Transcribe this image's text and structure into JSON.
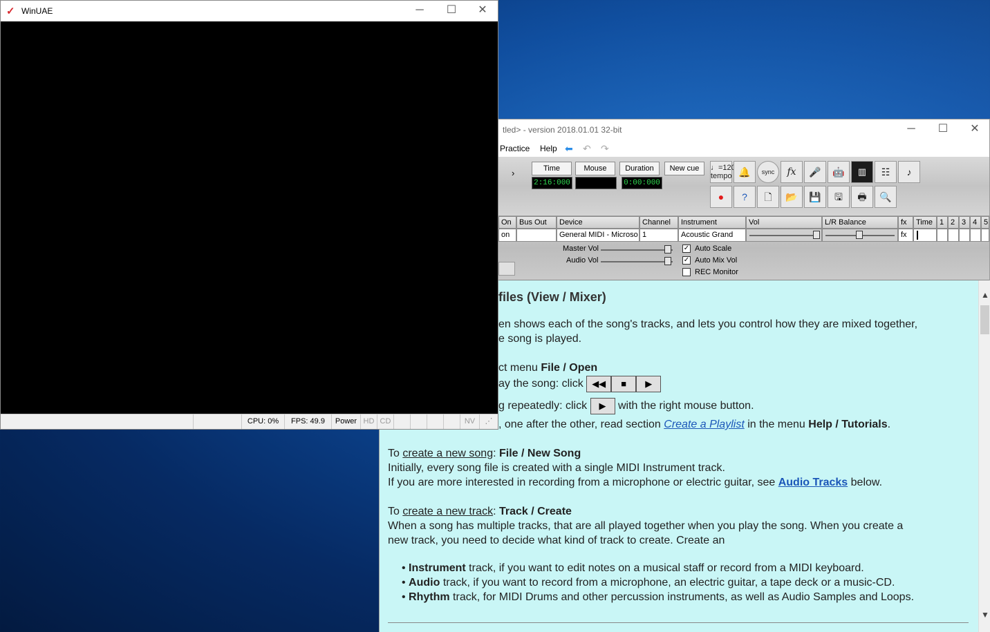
{
  "winuae": {
    "title": "WinUAE",
    "status": {
      "cpu": "CPU: 0%",
      "fps": "FPS: 49.9",
      "power": "Power",
      "hd": "HD",
      "cd": "CD",
      "nv": "NV"
    }
  },
  "app": {
    "title_fragment": "tled> - version 2018.01.01 32-bit",
    "menu": [
      "Practice",
      "Help"
    ],
    "time_labels": {
      "time": "Time",
      "mouse": "Mouse",
      "duration": "Duration",
      "new_cue": "New cue"
    },
    "time_values": {
      "time": "2:16:000",
      "mouse": "",
      "duration": "0:00:000"
    },
    "tempo": {
      "bpm": "♩=120",
      "label": "tempo"
    },
    "mixer": {
      "headers": [
        "On",
        "Bus Out",
        "Device",
        "Channel",
        "Instrument",
        "Vol",
        "L/R Balance",
        "fx",
        "Time",
        "1",
        "2",
        "3",
        "4",
        "5"
      ],
      "row": {
        "on": "on",
        "bus_out": "",
        "device": "General MIDI - Microso",
        "channel": "1",
        "instrument": "Acoustic Grand",
        "fx": "fx"
      },
      "master_vol": "Master Vol",
      "audio_vol": "Audio Vol",
      "auto_scale": "Auto Scale",
      "auto_mix_vol": "Auto Mix Vol",
      "rec_monitor": "REC Monitor"
    },
    "help": {
      "heading": "files (View / Mixer)",
      "p1a": "en shows each of the song's tracks, and lets you control how they are mixed together,",
      "p1b": "e song is played.",
      "open_pre": "ct menu ",
      "open_bold": "File / Open",
      "play_pre": "ay the song: click",
      "repeat_pre": "g repeatedly: click",
      "repeat_post": "with the right mouse button.",
      "playlist_pre": ", one after the other, read section ",
      "playlist_link": "Create a Playlist",
      "playlist_mid": " in the menu ",
      "playlist_bold": "Help / Tutorials",
      "playlist_end": ".",
      "newsong_to": "To ",
      "newsong_u": "create a new song",
      "newsong_colon": ": ",
      "newsong_bold": "File / New Song",
      "newsong_l1": "Initially, every song file is created with a single MIDI Instrument track.",
      "newsong_l2_pre": "If you are more interested in recording from a microphone or electric guitar, see ",
      "newsong_l2_link": "Audio Tracks",
      "newsong_l2_post": " below.",
      "newtrack_to": "To ",
      "newtrack_u": "create a new track",
      "newtrack_colon": ": ",
      "newtrack_bold": "Track / Create",
      "newtrack_l1": "When a song has multiple tracks, that are all played together when you play the song. When you create a",
      "newtrack_l2": "new track, you need to decide what kind of track to create. Create an",
      "bullets": [
        {
          "bold": "Instrument",
          "text": " track, if you want to edit notes on a musical staff or record from a MIDI keyboard."
        },
        {
          "bold": "Audio",
          "text": " track, if you want to record from a microphone, an electric guitar, a tape deck or a music-CD."
        },
        {
          "bold": "Rhythm",
          "text": " track, for MIDI Drums and other percussion instruments, as well as Audio Samples and Loops."
        }
      ]
    }
  },
  "icons": [
    "minimize-icon",
    "maximize-icon",
    "close-icon",
    "back-arrow-icon",
    "undo-icon",
    "redo-icon",
    "record-icon",
    "help-icon",
    "new-file-icon",
    "open-folder-icon",
    "save-icon",
    "print-icon",
    "zoom-icon"
  ]
}
